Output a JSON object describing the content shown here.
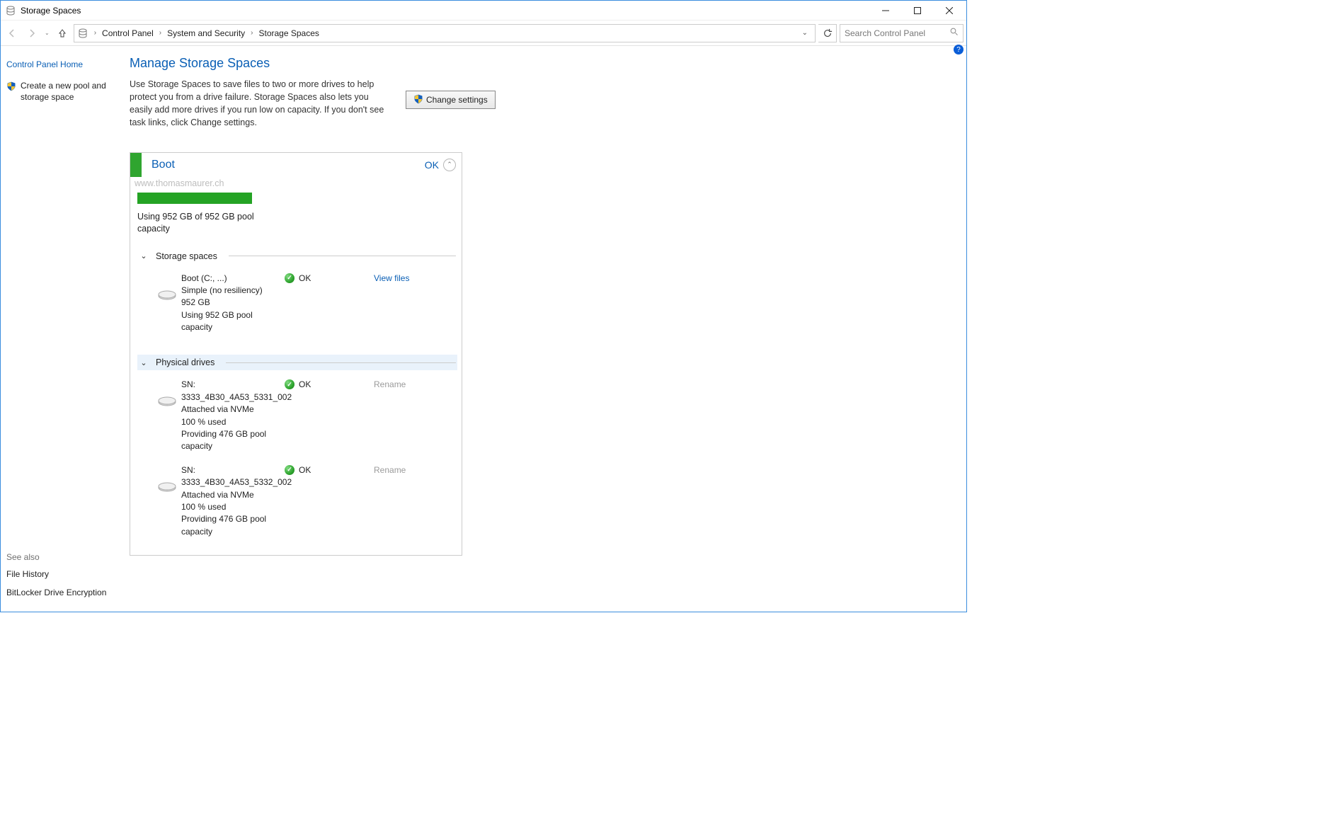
{
  "window": {
    "title": "Storage Spaces"
  },
  "breadcrumbs": {
    "items": [
      "Control Panel",
      "System and Security",
      "Storage Spaces"
    ]
  },
  "search": {
    "placeholder": "Search Control Panel"
  },
  "sidebar": {
    "home": "Control Panel Home",
    "create_pool": "Create a new pool and storage space",
    "see_also_label": "See also",
    "file_history": "File History",
    "bitlocker": "BitLocker Drive Encryption"
  },
  "page": {
    "title": "Manage Storage Spaces",
    "desc": "Use Storage Spaces to save files to two or more drives to help protect you from a drive failure. Storage Spaces also lets you easily add more drives if you run low on capacity. If you don't see task links, click Change settings.",
    "change_settings": "Change settings"
  },
  "pool": {
    "name": "Boot",
    "status": "OK",
    "watermark": "www.thomasmaurer.ch",
    "usage": "Using 952 GB of 952 GB pool capacity",
    "sections": {
      "spaces_label": "Storage spaces",
      "drives_label": "Physical drives"
    },
    "spaces": [
      {
        "name": "Boot (C:, ...)",
        "resiliency": "Simple (no resiliency)",
        "size": "952 GB",
        "usage": "Using 952 GB pool capacity",
        "status": "OK",
        "action_label": "View files"
      }
    ],
    "drives": [
      {
        "sn_label": "SN:",
        "sn": "3333_4B30_4A53_5331_002",
        "attach": "Attached via NVMe",
        "used": "100 % used",
        "providing": "Providing 476 GB pool capacity",
        "status": "OK",
        "action_label": "Rename"
      },
      {
        "sn_label": "SN:",
        "sn": "3333_4B30_4A53_5332_002",
        "attach": "Attached via NVMe",
        "used": "100 % used",
        "providing": "Providing 476 GB pool capacity",
        "status": "OK",
        "action_label": "Rename"
      }
    ]
  }
}
